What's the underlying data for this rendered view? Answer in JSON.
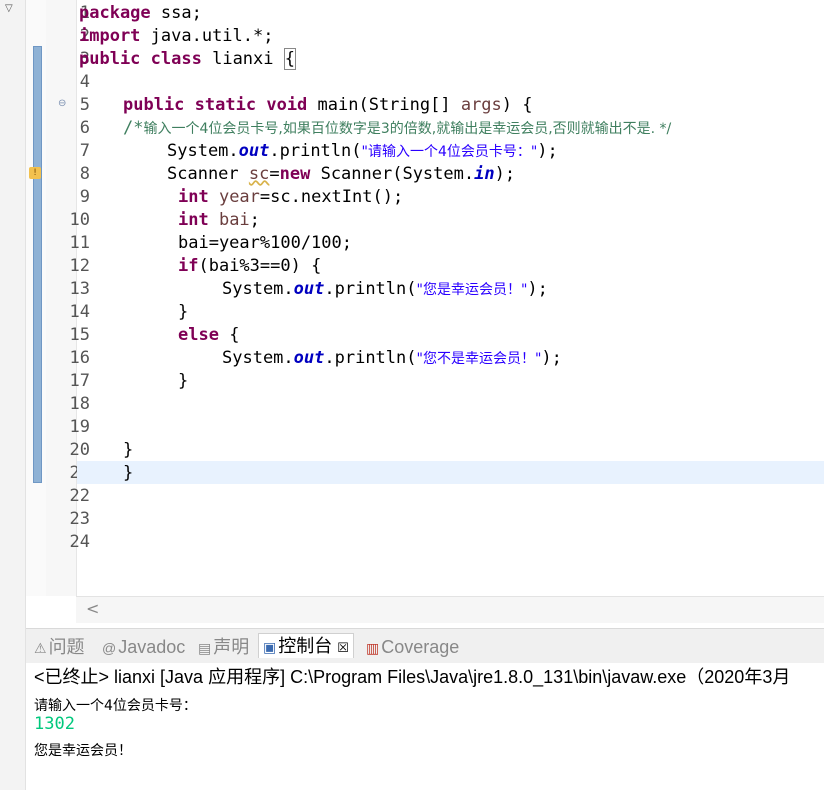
{
  "window": {
    "menu_icon": "chevron-down-icon"
  },
  "editor": {
    "line_numbers": [
      "1",
      "2",
      "3",
      "4",
      "5",
      "6",
      "7",
      "8",
      "9",
      "10",
      "11",
      "12",
      "13",
      "14",
      "15",
      "16",
      "17",
      "18",
      "19",
      "20",
      "21",
      "22",
      "23",
      "24"
    ],
    "fold_marker": "⊖",
    "code": {
      "l1": {
        "kw": "package",
        "rest": " ssa;"
      },
      "l2": {
        "kw": "import",
        "rest": " java.util.*;"
      },
      "l3": {
        "kw1": "public",
        "kw2": "class",
        "rest": " lianxi ",
        "brace": "{"
      },
      "l5": {
        "kw1": "public",
        "kw2": "static",
        "kw3": "void",
        "rest": " main(String[] ",
        "param": "args",
        "tail": ") {"
      },
      "l6": {
        "comment_start": "/*",
        "comment_text": "输入一个4位会员卡号,如果百位数字是3的倍数,就输出是幸运会员,否则就输出不是. */"
      },
      "l7": {
        "a": "System.",
        "field": "out",
        "b": ".println(",
        "str": "\"请输入一个4位会员卡号：\"",
        "c": ");"
      },
      "l8": {
        "a": "Scanner ",
        "var": "sc",
        "b": "=",
        "kw": "new",
        "c": " Scanner(System.",
        "field": "in",
        "d": ");"
      },
      "l9": {
        "kw": "int",
        "var": " year",
        "rest": "=sc.nextInt();"
      },
      "l10": {
        "kw": "int",
        "var": " bai",
        "rest": ";"
      },
      "l11": {
        "text": "bai=year%100/100;"
      },
      "l12": {
        "kw": "if",
        "rest": "(bai%3==0) {"
      },
      "l13": {
        "a": "System.",
        "field": "out",
        "b": ".println(",
        "str": "\"您是幸运会员！\"",
        "c": ");"
      },
      "l14": {
        "text": "}"
      },
      "l15": {
        "kw": "else",
        "rest": " {"
      },
      "l16": {
        "a": "System.",
        "field": "out",
        "b": ".println(",
        "str": "\"您不是幸运会员！\"",
        "c": ");"
      },
      "l17": {
        "text": "}"
      },
      "l20": {
        "text": "}"
      },
      "l21": {
        "text": "}"
      }
    },
    "scroll_left": "<"
  },
  "bottom_tabs": [
    {
      "label": "问题",
      "icon": "problems-icon"
    },
    {
      "label": "Javadoc",
      "icon": "at-icon"
    },
    {
      "label": "声明",
      "icon": "declaration-icon"
    },
    {
      "label": "控制台",
      "icon": "console-icon",
      "close": "☒"
    },
    {
      "label": "Coverage",
      "icon": "coverage-icon"
    }
  ],
  "console": {
    "header": "<已终止> lianxi [Java 应用程序] C:\\Program Files\\Java\\jre1.8.0_131\\bin\\javaw.exe（2020年3月",
    "prompt": "请输入一个4位会员卡号：",
    "input": "1302",
    "output": "您是幸运会员！"
  }
}
